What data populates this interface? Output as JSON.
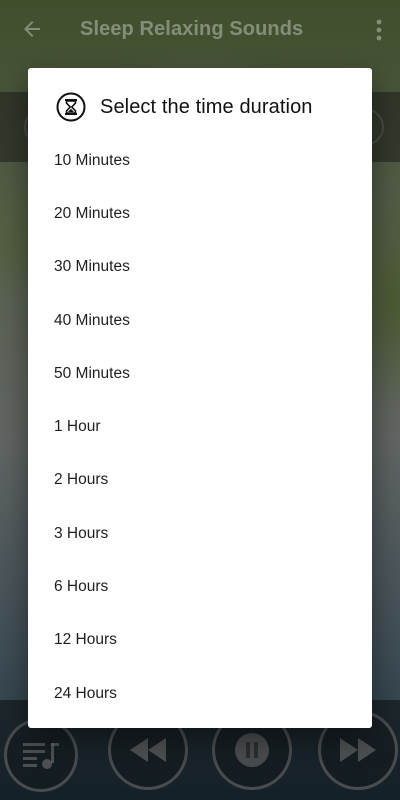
{
  "app_bar": {
    "title": "Sleep Relaxing Sounds",
    "back_icon": "arrow-left-icon",
    "more_icon": "more-vert-icon"
  },
  "dialog": {
    "icon": "hourglass-icon",
    "title": "Select the time duration",
    "options": [
      {
        "label": "10 Minutes"
      },
      {
        "label": "20 Minutes"
      },
      {
        "label": "30 Minutes"
      },
      {
        "label": "40 Minutes"
      },
      {
        "label": "50 Minutes"
      },
      {
        "label": "1 Hour"
      },
      {
        "label": "2 Hours"
      },
      {
        "label": "3 Hours"
      },
      {
        "label": "6 Hours"
      },
      {
        "label": "12 Hours"
      },
      {
        "label": "24 Hours"
      }
    ]
  },
  "player": {
    "playlist_icon": "playlist-music-icon",
    "rewind_icon": "rewind-icon",
    "pause_icon": "pause-icon",
    "forward_icon": "fast-forward-icon"
  },
  "colors": {
    "dialog_background": "#ffffff",
    "scrim": "rgba(0,0,0,0.55)",
    "text_primary": "#111111"
  }
}
